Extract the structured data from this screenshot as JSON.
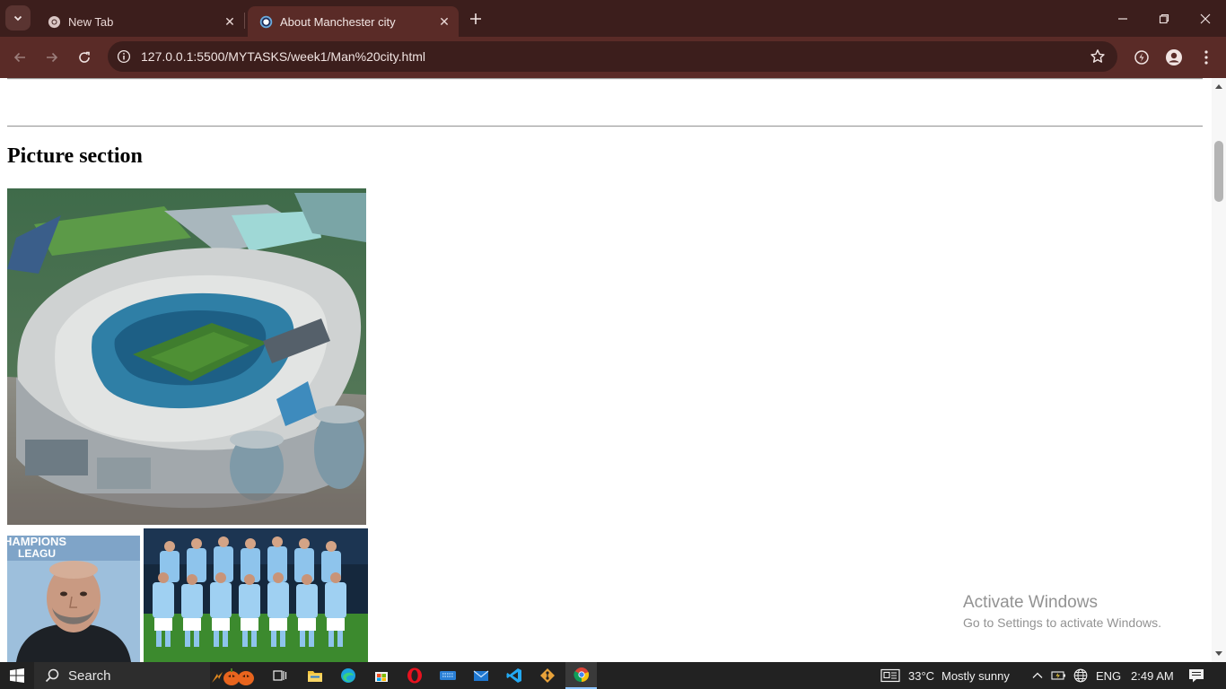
{
  "browser": {
    "tabs": [
      {
        "title": "New Tab",
        "favicon": "chrome-icon",
        "active": false
      },
      {
        "title": "About Manchester city",
        "favicon": "man-city-crest-icon",
        "active": true
      }
    ],
    "url": "127.0.0.1:5500/MYTASKS/week1/Man%20city.html",
    "theme": {
      "frame": "#3c1e1c",
      "toolbar": "#5a2b27",
      "omnibox": "#3c1e1c"
    }
  },
  "page": {
    "section_heading": "Picture section",
    "images": [
      {
        "name": "stadium-photo",
        "depicts": "aerial-stadium"
      },
      {
        "name": "manager-photo",
        "depicts": "portrait",
        "caption_text": "HAMPIONS",
        "caption_text2": "LEAGU"
      },
      {
        "name": "team-photo",
        "depicts": "team-lineup"
      }
    ]
  },
  "watermark": {
    "line1": "Activate Windows",
    "line2": "Go to Settings to activate Windows."
  },
  "taskbar": {
    "search_label": "Search",
    "pinned_apps": [
      "file-explorer-icon",
      "edge-icon",
      "store-icon",
      "opera-icon",
      "keyboard-icon",
      "mail-icon",
      "vscode-icon",
      "git-icon",
      "chrome-icon"
    ],
    "weather": {
      "temperature": "33°C",
      "condition": "Mostly sunny"
    },
    "language": "ENG",
    "time": "2:49 AM"
  }
}
